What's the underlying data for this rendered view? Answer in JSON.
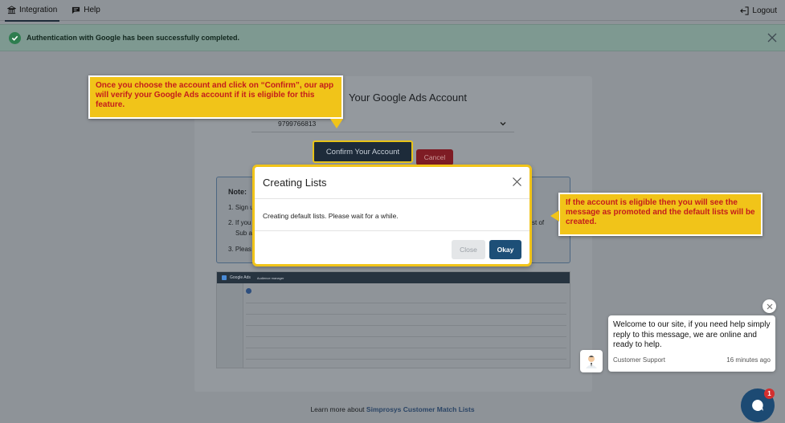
{
  "nav": {
    "items": [
      {
        "label": "Integration",
        "icon": "bank-icon"
      },
      {
        "label": "Help",
        "icon": "chat-icon"
      }
    ],
    "logout_label": "Logout"
  },
  "alert": {
    "message": "Authentication with Google has been successfully completed."
  },
  "card": {
    "title_fragment": "Your Google Ads Account",
    "account_value": "9799766813",
    "confirm_label": "Confirm Your Account",
    "cancel_label": "Cancel",
    "note": {
      "title": "Note:",
      "line1": "1. Sign u",
      "line2": "2. If you",
      "line2b": "Sub a",
      "line2_right": "st of",
      "line3": "3. Pleas"
    },
    "screenshot": {
      "app_name": "Google Ads",
      "section": "Audience manager"
    },
    "footer_text": "Learn more about",
    "footer_link": "Simprosys Customer Match Lists"
  },
  "modal": {
    "title": "Creating Lists",
    "body": "Creating default lists. Please wait for a while.",
    "close_label": "Close",
    "okay_label": "Okay"
  },
  "callouts": {
    "first": "Once you choose the account and click on “Confirm”, our app will verify your Google Ads account if it is eligible for this feature.",
    "second": "If the account is eligible then you will see the message as promoted and the default lists will be created."
  },
  "chat": {
    "message": "Welcome to our site, if you need help simply reply to this message, we are online and ready to help.",
    "agent": "Customer Support",
    "time": "16 minutes ago",
    "badge": "1"
  },
  "colors": {
    "highlight": "#f1c419",
    "callout_text": "#c41c1c",
    "primary": "#1d4f77",
    "success": "#2e7d4f"
  }
}
